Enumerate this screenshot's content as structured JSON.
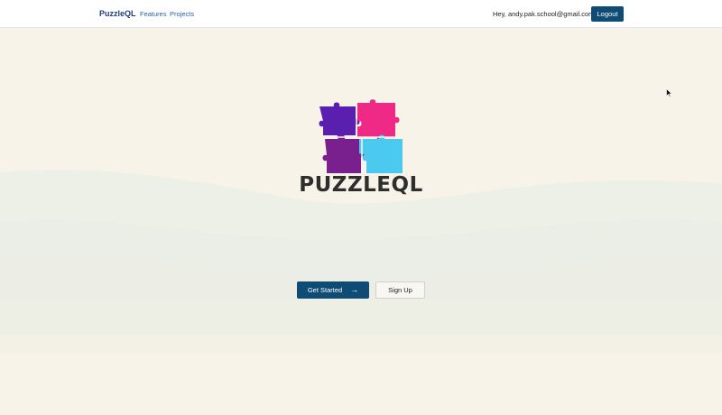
{
  "navbar": {
    "brand": "PuzzleQL",
    "links": [
      {
        "label": "Features"
      },
      {
        "label": "Projects"
      }
    ],
    "greeting": "Hey, andy.pak.school@gmail.com!",
    "logout_label": "Logout"
  },
  "hero": {
    "logo_text": "PUZZLEQL",
    "logo_icon": "puzzle-pieces-icon",
    "get_started_label": "Get Started",
    "get_started_icon": "arrow-right-icon",
    "signup_label": "Sign Up"
  },
  "colors": {
    "background": "#f7f3e8",
    "primary": "#0f4c75",
    "brand_text": "#1f3c7a",
    "piece_purple": "#5b1fb0",
    "piece_pink": "#ef2a86",
    "piece_plum": "#7a1f8e",
    "piece_cyan": "#4cc9ee"
  }
}
